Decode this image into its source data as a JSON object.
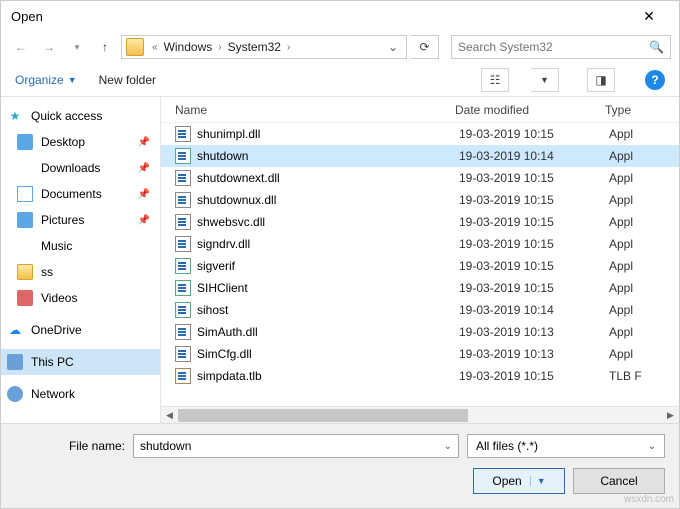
{
  "window": {
    "title": "Open"
  },
  "nav": {
    "crumbs": [
      "Windows",
      "System32"
    ],
    "search_placeholder": "Search System32"
  },
  "toolbar": {
    "organize": "Organize",
    "new_folder": "New folder"
  },
  "sidebar": {
    "quick_access": "Quick access",
    "items": [
      {
        "label": "Desktop",
        "icon": "desktop",
        "pinned": true
      },
      {
        "label": "Downloads",
        "icon": "down",
        "pinned": true
      },
      {
        "label": "Documents",
        "icon": "doc",
        "pinned": true
      },
      {
        "label": "Pictures",
        "icon": "pic",
        "pinned": true
      },
      {
        "label": "Music",
        "icon": "music",
        "pinned": false
      },
      {
        "label": "ss",
        "icon": "folder",
        "pinned": false
      },
      {
        "label": "Videos",
        "icon": "video",
        "pinned": false
      }
    ],
    "onedrive": "OneDrive",
    "this_pc": "This PC",
    "network": "Network"
  },
  "columns": {
    "name": "Name",
    "date": "Date modified",
    "type": "Type"
  },
  "files": [
    {
      "name": "shunimpl.dll",
      "date": "19-03-2019 10:15",
      "type": "Appl",
      "kind": "dll",
      "selected": false
    },
    {
      "name": "shutdown",
      "date": "19-03-2019 10:14",
      "type": "Appl",
      "kind": "exe",
      "selected": true
    },
    {
      "name": "shutdownext.dll",
      "date": "19-03-2019 10:15",
      "type": "Appl",
      "kind": "dll",
      "selected": false
    },
    {
      "name": "shutdownux.dll",
      "date": "19-03-2019 10:15",
      "type": "Appl",
      "kind": "dll",
      "selected": false
    },
    {
      "name": "shwebsvc.dll",
      "date": "19-03-2019 10:15",
      "type": "Appl",
      "kind": "dll",
      "selected": false
    },
    {
      "name": "signdrv.dll",
      "date": "19-03-2019 10:15",
      "type": "Appl",
      "kind": "dll",
      "selected": false
    },
    {
      "name": "sigverif",
      "date": "19-03-2019 10:15",
      "type": "Appl",
      "kind": "exe",
      "selected": false
    },
    {
      "name": "SIHClient",
      "date": "19-03-2019 10:15",
      "type": "Appl",
      "kind": "exe",
      "selected": false
    },
    {
      "name": "sihost",
      "date": "19-03-2019 10:14",
      "type": "Appl",
      "kind": "exe",
      "selected": false
    },
    {
      "name": "SimAuth.dll",
      "date": "19-03-2019 10:13",
      "type": "Appl",
      "kind": "dll",
      "selected": false
    },
    {
      "name": "SimCfg.dll",
      "date": "19-03-2019 10:13",
      "type": "Appl",
      "kind": "dll",
      "selected": false
    },
    {
      "name": "simpdata.tlb",
      "date": "19-03-2019 10:15",
      "type": "TLB F",
      "kind": "cfg",
      "selected": false
    }
  ],
  "footer": {
    "filename_label": "File name:",
    "filename_value": "shutdown",
    "filter": "All files (*.*)",
    "open": "Open",
    "cancel": "Cancel"
  },
  "watermark": "wsxdn.com"
}
